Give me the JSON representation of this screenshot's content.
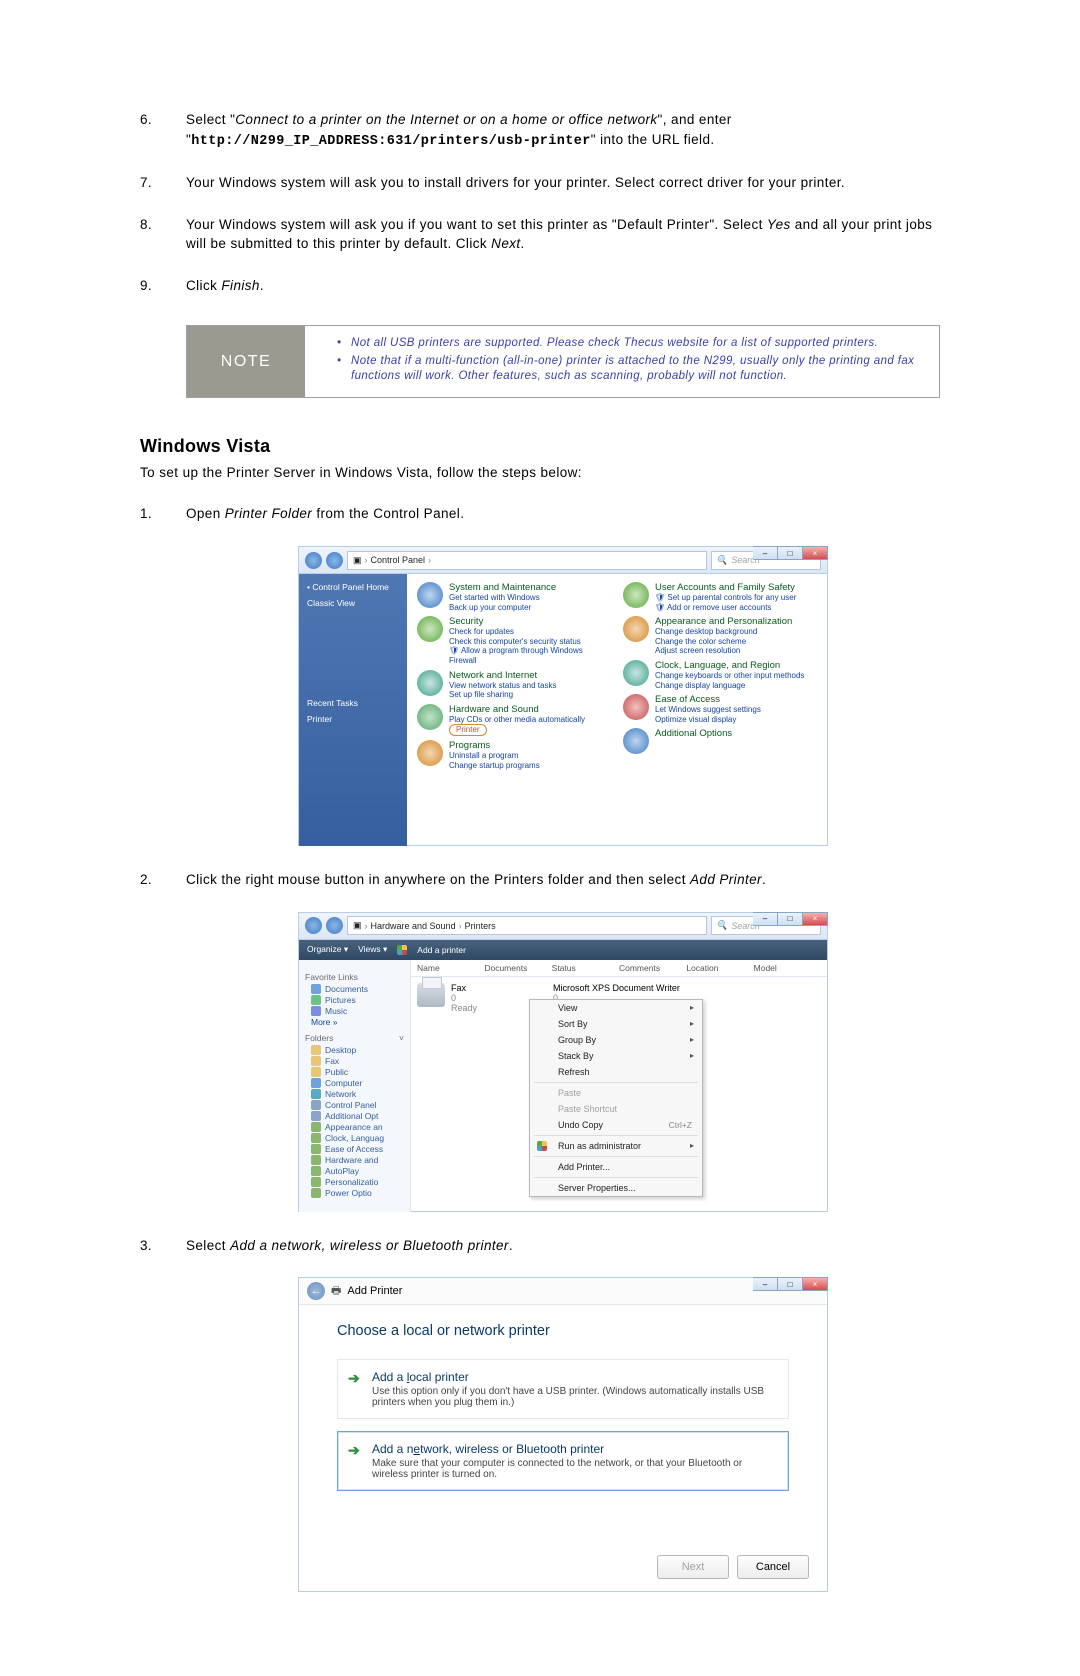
{
  "steps": {
    "s6_no": "6.",
    "s6a": "Select \"",
    "s6b": "Connect to a printer on the Internet or on a home or office network",
    "s6c": "\", and enter \"",
    "s6_url": "http://N299_IP_ADDRESS:631/printers/usb-printer",
    "s6d": "\" into the URL field.",
    "s7_no": "7.",
    "s7": "Your Windows system will ask you to install drivers for your printer. Select correct driver for your printer.",
    "s8_no": "8.",
    "s8a": "Your Windows system will ask you if you want to set this printer as \"Default Printer\". Select ",
    "s8b": "Yes",
    "s8c": " and all your print jobs will be submitted to this printer by default. Click ",
    "s8d": "Next",
    "s8e": ".",
    "s9_no": "9.",
    "s9a": "Click ",
    "s9b": "Finish",
    "s9c": "."
  },
  "note": {
    "label": "NOTE",
    "n1": "Not all USB printers are supported. Please check Thecus website for a list of supported printers.",
    "n2": "Note that if a multi-function (all-in-one) printer is attached to the N299, usually only the printing and fax functions will work. Other features, such as scanning, probably will not function."
  },
  "vista": {
    "heading": "Windows Vista",
    "intro": "To set up the Printer Server in Windows Vista, follow the steps below:",
    "s1_no": "1.",
    "s1a": "Open ",
    "s1b": "Printer Folder",
    "s1c": " from the Control Panel.",
    "s2_no": "2.",
    "s2a": "Click the right mouse button in anywhere on the Printers folder and then select ",
    "s2b": "Add Printer",
    "s2c": ".",
    "s3_no": "3.",
    "s3a": "Select ",
    "s3b": "Add a network, wireless or Bluetooth printer",
    "s3c": "."
  },
  "ss1": {
    "wc_min": "–",
    "wc_max": "□",
    "wc_close": "×",
    "path": "Control Panel",
    "search": "Search",
    "side_home": "Control Panel Home",
    "side_classic": "Classic View",
    "side_recent": "Recent Tasks",
    "side_printer": "Printer",
    "left": {
      "t1": "System and Maintenance",
      "s1a": "Get started with Windows",
      "s1b": "Back up your computer",
      "t2": "Security",
      "s2a": "Check for updates",
      "s2b": "Check this computer's security status",
      "s2c": "Allow a program through Windows Firewall",
      "t3": "Network and Internet",
      "s3a": "View network status and tasks",
      "s3b": "Set up file sharing",
      "t4": "Hardware and Sound",
      "s4a": "Play CDs or other media automatically",
      "s4b": "Printer",
      "t5": "Programs",
      "s5a": "Uninstall a program",
      "s5b": "Change startup programs"
    },
    "right": {
      "t1": "User Accounts and Family Safety",
      "s1a": "Set up parental controls for any user",
      "s1b": "Add or remove user accounts",
      "t2": "Appearance and Personalization",
      "s2a": "Change desktop background",
      "s2b": "Change the color scheme",
      "s2c": "Adjust screen resolution",
      "t3": "Clock, Language, and Region",
      "s3a": "Change keyboards or other input methods",
      "s3b": "Change display language",
      "t4": "Ease of Access",
      "s4a": "Let Windows suggest settings",
      "s4b": "Optimize visual display",
      "t5": "Additional Options"
    }
  },
  "ss2": {
    "path1": "Hardware and Sound",
    "path2": "Printers",
    "search": "Search",
    "tb_org": "Organize ▾",
    "tb_views": "Views ▾",
    "tb_add": "Add a printer",
    "side_fav": "Favorite Links",
    "side_docs": "Documents",
    "side_pics": "Pictures",
    "side_music": "Music",
    "side_more": "More »",
    "side_folders": "Folders",
    "side_desktop": "Desktop",
    "side_fax": "Fax",
    "side_public": "Public",
    "side_computer": "Computer",
    "side_network": "Network",
    "side_cpanel": "Control Panel",
    "side_addopt": "Additional Opt",
    "side_appear": "Appearance an",
    "side_clock": "Clock, Languag",
    "side_ease": "Ease of Access",
    "side_hw": "Hardware and",
    "side_auto": "AutoPlay",
    "side_pers": "Personalizatio",
    "side_power": "Power Optio",
    "cols": {
      "c1": "Name",
      "c2": "Documents",
      "c3": "Status",
      "c4": "Comments",
      "c5": "Location",
      "c6": "Model"
    },
    "fax": "Fax",
    "fax_doc": "0",
    "fax_status": "Ready",
    "xps": "Microsoft XPS Document Writer",
    "xps_doc": "0",
    "menu": {
      "view": "View",
      "sort": "Sort By",
      "group": "Group By",
      "stack": "Stack By",
      "refresh": "Refresh",
      "paste": "Paste",
      "paste_sc": "Paste Shortcut",
      "undo": "Undo Copy",
      "undo_k": "Ctrl+Z",
      "runas": "Run as administrator",
      "add": "Add Printer...",
      "srv": "Server Properties..."
    }
  },
  "ss3": {
    "title_icon": "←",
    "title": "Add Printer",
    "choose": "Choose a local or network printer",
    "opt1_pre": "Add a ",
    "opt1_u": "l",
    "opt1_post": "ocal printer",
    "opt1_sub": "Use this option only if you don't have a USB printer. (Windows automatically installs USB printers when you plug them in.)",
    "opt2_pre": "Add a n",
    "opt2_u": "e",
    "opt2_post": "twork, wireless or Bluetooth printer",
    "opt2_sub": "Make sure that your computer is connected to the network, or that your Bluetooth or wireless printer is turned on.",
    "next": "Next",
    "cancel": "Cancel"
  }
}
